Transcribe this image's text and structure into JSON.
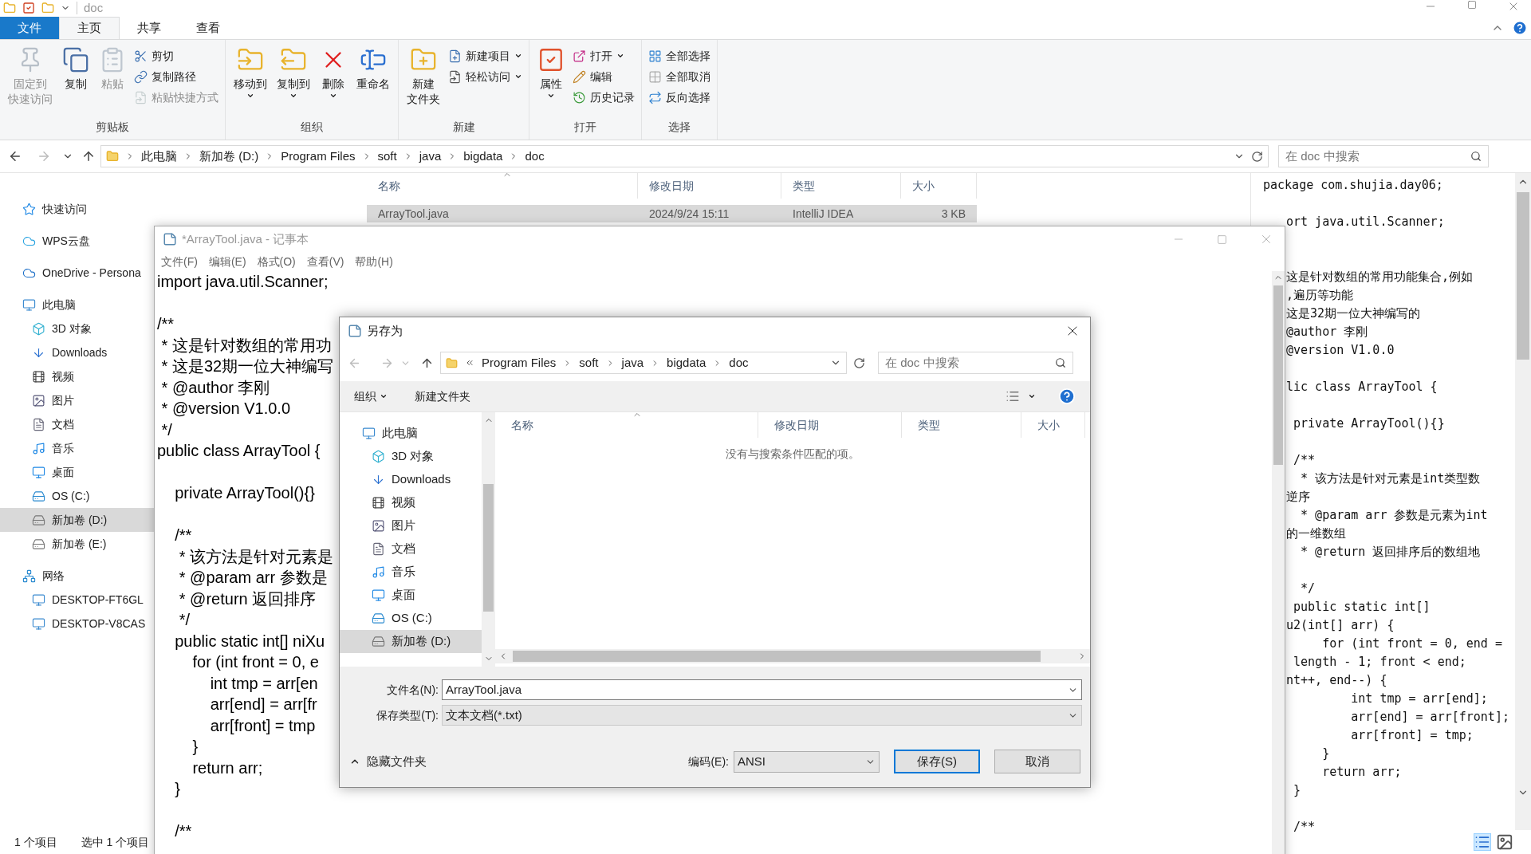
{
  "explorer": {
    "title": "doc",
    "tabs": [
      {
        "label": "文件",
        "kind": "file",
        "selected": false
      },
      {
        "label": "主页",
        "kind": "tab",
        "selected": true
      },
      {
        "label": "共享",
        "kind": "tab",
        "selected": false
      },
      {
        "label": "查看",
        "kind": "tab",
        "selected": false
      }
    ],
    "ribbon": [
      {
        "name": "剪贴板",
        "items": [
          {
            "kind": "large",
            "lines": [
              "固定到",
              "快速访问"
            ],
            "disabled": true,
            "dropdown": false
          },
          {
            "kind": "large",
            "lines": [
              "复制"
            ],
            "disabled": false,
            "dropdown": false
          },
          {
            "kind": "large",
            "lines": [
              "粘贴"
            ],
            "disabled": true,
            "dropdown": false
          },
          {
            "kind": "stack",
            "commands": [
              {
                "label": "剪切",
                "disabled": false,
                "dropdown": false
              },
              {
                "label": "复制路径",
                "disabled": false,
                "dropdown": false
              },
              {
                "label": "粘贴快捷方式",
                "disabled": true,
                "dropdown": false
              }
            ]
          }
        ]
      },
      {
        "name": "组织",
        "items": [
          {
            "kind": "large",
            "lines": [
              "移动到"
            ],
            "disabled": false,
            "dropdown": true
          },
          {
            "kind": "large",
            "lines": [
              "复制到"
            ],
            "disabled": false,
            "dropdown": true
          },
          {
            "kind": "large",
            "lines": [
              "删除"
            ],
            "disabled": false,
            "dropdown": true
          },
          {
            "kind": "large",
            "lines": [
              "重命名"
            ],
            "disabled": false,
            "dropdown": false
          }
        ]
      },
      {
        "name": "新建",
        "items": [
          {
            "kind": "large",
            "lines": [
              "新建",
              "文件夹"
            ],
            "disabled": false,
            "dropdown": false
          },
          {
            "kind": "stack",
            "commands": [
              {
                "label": "新建项目",
                "disabled": false,
                "dropdown": true
              },
              {
                "label": "轻松访问",
                "disabled": false,
                "dropdown": true
              }
            ]
          }
        ]
      },
      {
        "name": "打开",
        "items": [
          {
            "kind": "large",
            "lines": [
              "属性"
            ],
            "disabled": false,
            "dropdown": true
          },
          {
            "kind": "stack",
            "commands": [
              {
                "label": "打开",
                "disabled": false,
                "dropdown": true
              },
              {
                "label": "编辑",
                "disabled": false,
                "dropdown": false
              },
              {
                "label": "历史记录",
                "disabled": false,
                "dropdown": false
              }
            ]
          }
        ]
      },
      {
        "name": "选择",
        "items": [
          {
            "kind": "stack",
            "commands": [
              {
                "label": "全部选择",
                "disabled": false,
                "dropdown": false
              },
              {
                "label": "全部取消",
                "disabled": false,
                "dropdown": false
              },
              {
                "label": "反向选择",
                "disabled": false,
                "dropdown": false
              }
            ]
          }
        ]
      }
    ],
    "breadcrumbs": [
      "此电脑",
      "新加卷 (D:)",
      "Program Files",
      "soft",
      "java",
      "bigdata",
      "doc"
    ],
    "search": {
      "placeholder": "在 doc 中搜索"
    },
    "nav": [
      {
        "label": "快速访问",
        "selected": false
      },
      {
        "label": "WPS云盘",
        "selected": false
      },
      {
        "label": "OneDrive - Persona",
        "selected": false
      },
      {
        "label": "此电脑",
        "selected": false,
        "children": [
          {
            "label": "3D 对象",
            "selected": false
          },
          {
            "label": "Downloads",
            "selected": false
          },
          {
            "label": "视频",
            "selected": false
          },
          {
            "label": "图片",
            "selected": false
          },
          {
            "label": "文档",
            "selected": false
          },
          {
            "label": "音乐",
            "selected": false
          },
          {
            "label": "桌面",
            "selected": false
          },
          {
            "label": "OS (C:)",
            "selected": false
          },
          {
            "label": "新加卷 (D:)",
            "selected": true
          },
          {
            "label": "新加卷 (E:)",
            "selected": false
          }
        ]
      },
      {
        "label": "网络",
        "selected": false,
        "children": [
          {
            "label": "DESKTOP-FT6GL",
            "selected": false
          },
          {
            "label": "DESKTOP-V8CAS",
            "selected": false
          }
        ]
      }
    ],
    "columns": [
      "名称",
      "修改日期",
      "类型",
      "大小"
    ],
    "rows": [
      {
        "cells": [
          "ArrayTool.java",
          "2024/9/24 15:11",
          "IntelliJ IDEA",
          "3 KB"
        ],
        "selected": true
      }
    ],
    "preview_blocks": [
      {
        "kind": "top",
        "lines": [
          "package com.shujia.day06;"
        ]
      },
      {
        "kind": "gap",
        "lines": [
          "ort java.util.Scanner;"
        ]
      },
      {
        "kind": "wide_gap",
        "lines": [
          "这是针对数组的常用功能集合,例如",
          ",遍历等功能",
          "这是32期一位大神编写的",
          "@author 李刚",
          "@version V1.0.0"
        ]
      },
      {
        "kind": "gap",
        "lines": [
          "lic class ArrayTool {"
        ]
      },
      {
        "kind": "gap",
        "lines": [
          " private ArrayTool(){}"
        ]
      },
      {
        "kind": "gap",
        "lines": [
          " /**",
          "  * 该方法是针对元素是int类型数",
          "逆序",
          "  * @param arr 参数是元素为int",
          "的一维数组",
          "  * @return 返回排序后的数组地"
        ]
      },
      {
        "kind": "gap",
        "lines": [
          "  */",
          " public static int[]",
          "u2(int[] arr) {",
          "     for (int front = 0, end =",
          " length - 1; front < end;",
          "nt++, end--) {",
          "         int tmp = arr[end];",
          "         arr[end] = arr[front];",
          "         arr[front] = tmp;",
          "     }",
          "     return arr;",
          " }"
        ]
      },
      {
        "kind": "gap",
        "lines": [
          " /**"
        ]
      }
    ],
    "status": [
      "1 个项目",
      "选中 1 个项目"
    ]
  },
  "notepad": {
    "title": "*ArrayTool.java - 记事本",
    "menu": [
      "文件(F)",
      "编辑(E)",
      "格式(O)",
      "查看(V)",
      "帮助(H)"
    ],
    "blocks": [
      {
        "kind": "top",
        "lines": [
          "import java.util.Scanner;"
        ]
      },
      {
        "kind": "gap",
        "lines": [
          "/**",
          " * 这是针对数组的常用功",
          " * 这是32期一位大神编写",
          " * @author 李刚",
          " * @version V1.0.0",
          " */",
          "public class ArrayTool {"
        ]
      },
      {
        "kind": "gap",
        "lines": [
          "    private ArrayTool(){}"
        ]
      },
      {
        "kind": "gap",
        "lines": [
          "    /**",
          "     * 该方法是针对元素是",
          "     * @param arr 参数是",
          "     * @return 返回排序",
          "     */",
          "    public static int[] niXu",
          "        for (int front = 0, e",
          "            int tmp = arr[en",
          "            arr[end] = arr[fr",
          "            arr[front] = tmp",
          "        }",
          "        return arr;",
          "    }"
        ]
      },
      {
        "kind": "gap",
        "lines": [
          "    /**"
        ]
      }
    ]
  },
  "dialog": {
    "title": "另存为",
    "breadcrumbs": [
      "Program Files",
      "soft",
      "java",
      "bigdata",
      "doc"
    ],
    "search": {
      "placeholder": "在 doc 中搜索"
    },
    "toolbar": [
      {
        "label": "组织",
        "dropdown": true
      },
      {
        "label": "新建文件夹",
        "dropdown": false
      }
    ],
    "nav": [
      {
        "label": "此电脑",
        "selected": false,
        "children": [
          {
            "label": "3D 对象",
            "selected": false
          },
          {
            "label": "Downloads",
            "selected": false
          },
          {
            "label": "视频",
            "selected": false
          },
          {
            "label": "图片",
            "selected": false
          },
          {
            "label": "文档",
            "selected": false
          },
          {
            "label": "音乐",
            "selected": false
          },
          {
            "label": "桌面",
            "selected": false
          },
          {
            "label": "OS (C:)",
            "selected": false
          },
          {
            "label": "新加卷 (D:)",
            "selected": true
          }
        ]
      }
    ],
    "columns": [
      "名称",
      "修改日期",
      "类型",
      "大小"
    ],
    "empty_message": "没有与搜索条件匹配的项。",
    "filename": {
      "label": "文件名(N):",
      "value": "ArrayTool.java"
    },
    "filetype": {
      "label": "保存类型(T):",
      "value": "文本文档(*.txt)"
    },
    "hide_folders": "隐藏文件夹",
    "encoding": {
      "label": "编码(E):",
      "value": "ANSI"
    },
    "buttons": [
      {
        "label": "保存(S)",
        "default": true
      },
      {
        "label": "取消",
        "default": false
      }
    ]
  }
}
